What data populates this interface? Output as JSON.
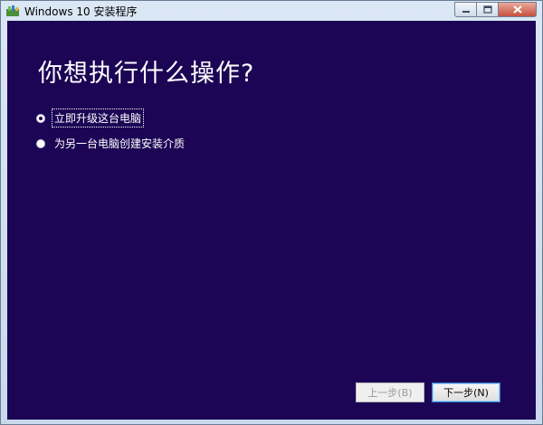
{
  "window": {
    "title": "Windows 10 安装程序",
    "icon": "setup-app-icon"
  },
  "main": {
    "heading": "你想执行什么操作?",
    "options": [
      {
        "label": "立即升级这台电脑",
        "selected": true
      },
      {
        "label": "为另一台电脑创建安装介质",
        "selected": false
      }
    ]
  },
  "footer": {
    "back_label": "上一步(B)",
    "back_enabled": false,
    "next_label": "下一步(N)"
  },
  "colors": {
    "content_background": "#1c0555",
    "text": "#ffffff"
  }
}
